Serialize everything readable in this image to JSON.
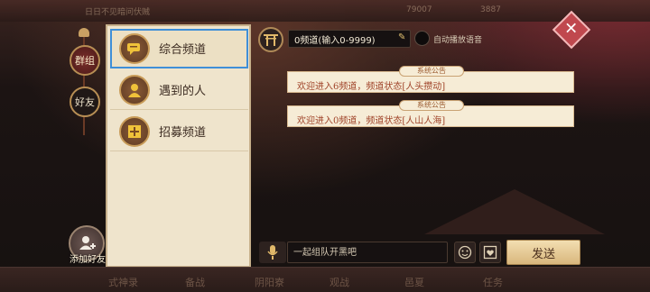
{
  "top_bar": {
    "title": "日日不见暗问伏贼",
    "gold": "79007",
    "jade": "3887"
  },
  "side_tabs": [
    {
      "label": "群组",
      "active": true
    },
    {
      "label": "好友",
      "active": false
    }
  ],
  "add_friend_label": "添加好友",
  "channels": [
    {
      "label": "综合频道",
      "icon": "chat-bubble-icon",
      "selected": true
    },
    {
      "label": "遇到的人",
      "icon": "person-icon",
      "selected": false
    },
    {
      "label": "招募频道",
      "icon": "plus-icon",
      "selected": false
    }
  ],
  "header": {
    "channel_value": "0频道(输入0-9999)",
    "auto_voice_label": "自动播放语音"
  },
  "notices": [
    {
      "tag": "系统公告",
      "text": "欢迎进入6频道，频道状态[人头攒动]"
    },
    {
      "tag": "系统公告",
      "text": "欢迎进入0频道，频道状态[人山人海]"
    }
  ],
  "input": {
    "placeholder": "一起组队开黑吧",
    "send_label": "发送"
  },
  "bottom_nav": [
    "式神录",
    "备战",
    "阴阳寮",
    "观战",
    "邑夏",
    "任务"
  ],
  "colors": {
    "panel_bg": "#efe4cc",
    "notice_text": "#a0442a",
    "accent_close": "#c0484e",
    "selected_outline": "#3f8fd8"
  }
}
